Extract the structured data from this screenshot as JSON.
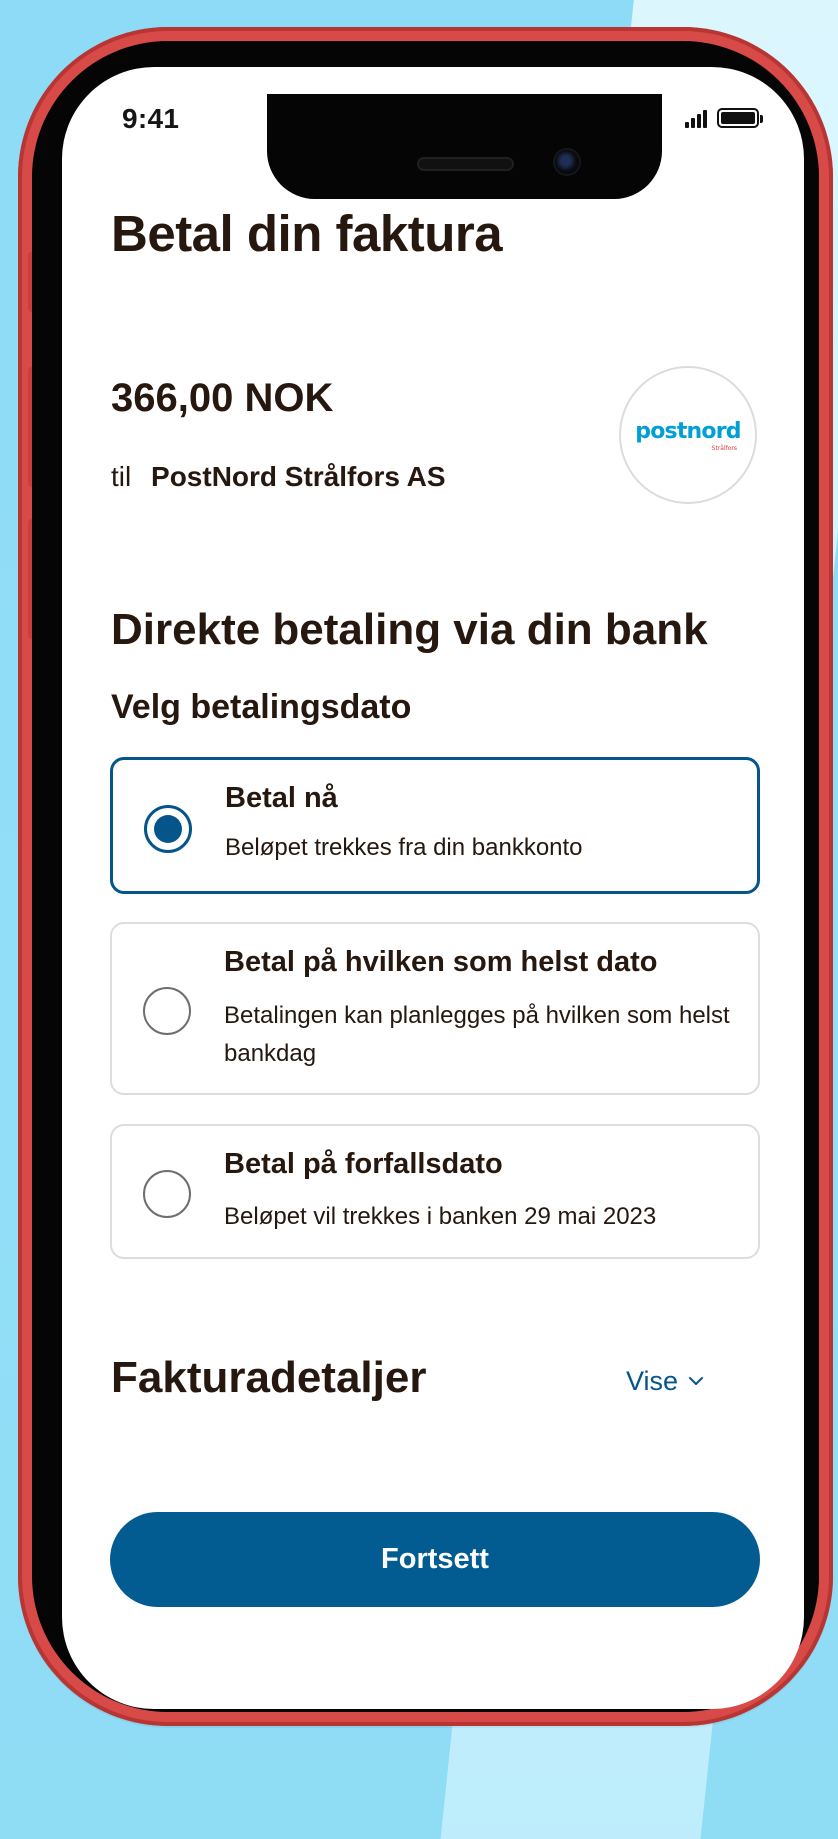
{
  "status_bar": {
    "time": "9:41",
    "signal_icon": "signal-bars-icon",
    "battery_icon": "battery-icon"
  },
  "page": {
    "title": "Betal din faktura"
  },
  "invoice": {
    "amount": "366,00 NOK",
    "recipient_prefix": "til",
    "recipient_name": "PostNord Strålfors AS",
    "logo_text": "postnord",
    "logo_subtext": "Strålfors"
  },
  "payment_section": {
    "heading": "Direkte betaling via din bank",
    "date_label": "Velg betalingsdato",
    "options": [
      {
        "title": "Betal nå",
        "description": "Beløpet trekkes fra din bankkonto",
        "selected": true
      },
      {
        "title": "Betal på hvilken som helst dato",
        "description": "Betalingen kan planlegges på hvilken som helst bankdag",
        "selected": false
      },
      {
        "title": "Betal på forfallsdato",
        "description": "Beløpet vil trekkes i banken 29 mai 2023",
        "selected": false
      }
    ]
  },
  "details": {
    "heading": "Fakturadetaljer",
    "toggle_label": "Vise",
    "toggle_icon": "chevron-down-icon"
  },
  "actions": {
    "continue_label": "Fortsett"
  },
  "colors": {
    "background": "#8fdcf6",
    "phone_frame": "#d84a48",
    "brand_blue": "#05558a",
    "button_blue": "#035c91",
    "text_dark": "#26170f",
    "logo_blue": "#00a0d6",
    "logo_red": "#e03a3e"
  }
}
